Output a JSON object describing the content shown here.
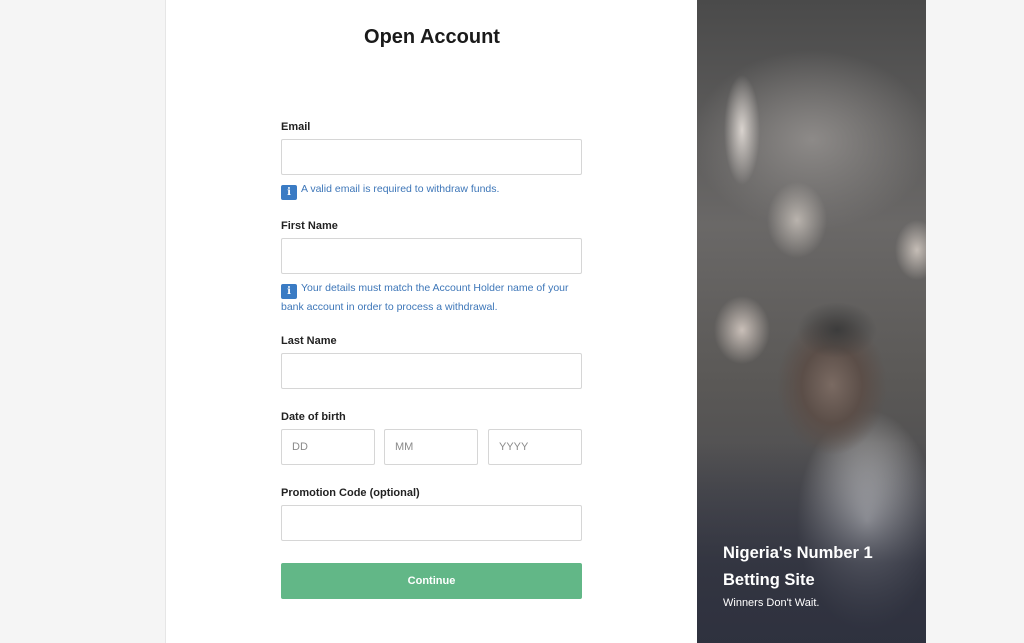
{
  "form": {
    "title": "Open Account",
    "email": {
      "label": "Email",
      "value": "",
      "placeholder": ""
    },
    "email_hint": "A valid email is required to withdraw funds.",
    "first_name": {
      "label": "First Name",
      "value": "",
      "placeholder": ""
    },
    "first_name_hint_line1": "Your details must match the Account Holder name of your",
    "first_name_hint_line2": "bank account in order to process a withdrawal.",
    "last_name": {
      "label": "Last Name",
      "value": "",
      "placeholder": ""
    },
    "dob": {
      "label": "Date of birth",
      "day_placeholder": "DD",
      "month_placeholder": "MM",
      "year_placeholder": "YYYY"
    },
    "promo": {
      "label": "Promotion Code (optional)",
      "value": "",
      "placeholder": ""
    },
    "continue_label": "Continue",
    "info_icon_glyph": "i"
  },
  "promo_panel": {
    "headline_line1": "Nigeria's Number 1",
    "headline_line2": "Betting Site",
    "tagline": "Winners Don't Wait."
  },
  "colors": {
    "button": "#62b787",
    "hint_text": "#3d76b8",
    "info_icon": "#3a7bc4"
  }
}
